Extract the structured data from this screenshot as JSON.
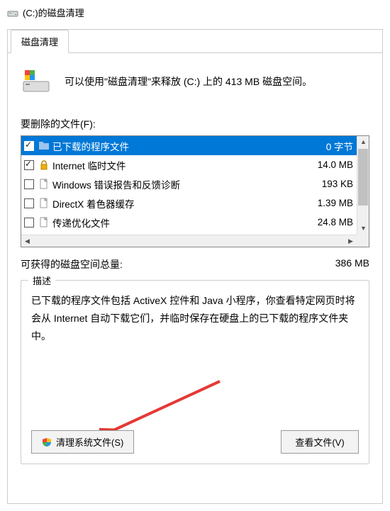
{
  "window": {
    "title": "(C:)的磁盘清理"
  },
  "tab": {
    "label": "磁盘清理"
  },
  "summary": {
    "text": "可以使用\"磁盘清理\"来释放  (C:) 上的 413 MB 磁盘空间。"
  },
  "files": {
    "section_label": "要删除的文件(F):",
    "items": [
      {
        "name": "已下载的程序文件",
        "size": "0 字节",
        "checked": true,
        "selected": true,
        "icon": "folder"
      },
      {
        "name": "Internet 临时文件",
        "size": "14.0 MB",
        "checked": true,
        "selected": false,
        "icon": "lock"
      },
      {
        "name": "Windows 错误报告和反馈诊断",
        "size": "193 KB",
        "checked": false,
        "selected": false,
        "icon": "file"
      },
      {
        "name": "DirectX 着色器缓存",
        "size": "1.39 MB",
        "checked": false,
        "selected": false,
        "icon": "file"
      },
      {
        "name": "传递优化文件",
        "size": "24.8 MB",
        "checked": false,
        "selected": false,
        "icon": "file"
      }
    ]
  },
  "total": {
    "label": "可获得的磁盘空间总量:",
    "value": "386 MB"
  },
  "desc": {
    "legend": "描述",
    "text": "已下载的程序文件包括 ActiveX 控件和 Java 小程序，你查看特定网页时将会从 Internet 自动下载它们，并临时保存在硬盘上的已下载的程序文件夹中。"
  },
  "buttons": {
    "clean_system": "清理系统文件(S)",
    "view_files": "查看文件(V)"
  }
}
